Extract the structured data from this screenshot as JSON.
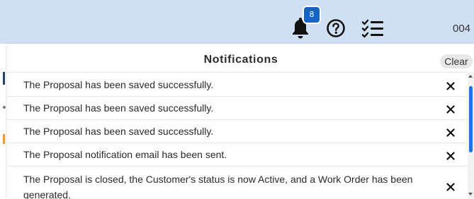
{
  "header": {
    "notification_count": "8",
    "user_code": "004",
    "icons": [
      "bell-icon",
      "help-circle-icon",
      "checklist-icon"
    ]
  },
  "left_strip": {
    "marks": [
      "navy-bar",
      "gray-dot",
      "orange-bar"
    ]
  },
  "panel": {
    "title": "Notifications",
    "clear_label": "Clear",
    "notifications": [
      "The Proposal has been saved successfully.",
      "The Proposal has been saved successfully.",
      "The Proposal has been saved successfully.",
      "The Proposal notification email has been sent.",
      "The Proposal is closed, the Customer's status is now Active, and a Work Order has been generated."
    ],
    "close_icon": "close-icon"
  },
  "colors": {
    "topbar": "#cfe0f5",
    "badge": "#1565c8",
    "scroll_thumb": "#1a73e8",
    "clear_pill": "#e8e8e8",
    "accent_orange": "#e69a3a",
    "accent_navy": "#24406e"
  }
}
